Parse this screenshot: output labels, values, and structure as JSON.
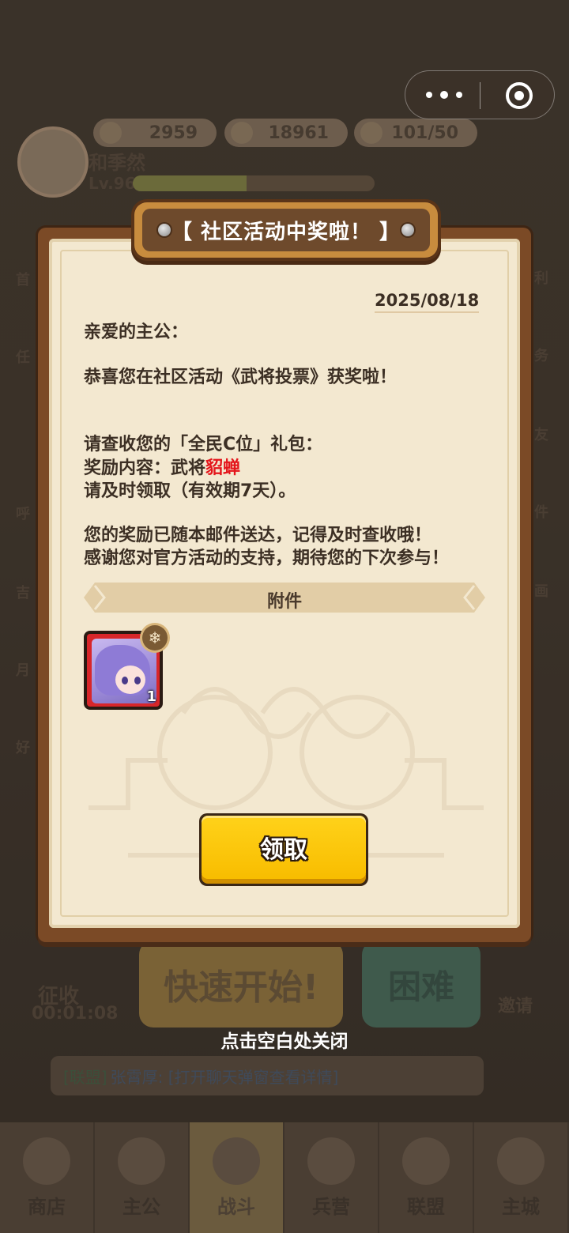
{
  "resources": [
    {
      "icon": "gold-ingot-icon",
      "value": "2959"
    },
    {
      "icon": "coin-icon",
      "value": "18961"
    },
    {
      "icon": "food-icon",
      "value": "101/50"
    }
  ],
  "player": {
    "name": "和季然",
    "level": "Lv.96",
    "xp_progress": 0.47
  },
  "side_left": [
    "首",
    "任",
    "呼",
    "吉",
    "月",
    "好"
  ],
  "side_right": [
    "利",
    "务",
    "友",
    "件",
    "画"
  ],
  "main_buttons": {
    "quick_start": "快速开始!",
    "hard": "困难",
    "collect": "征收",
    "collect_timer": "00:01:08",
    "invite": "邀请"
  },
  "chat": {
    "tag": "[联盟]",
    "text": "张霄厚: [打开聊天弹窗查看详情]"
  },
  "bottom_nav": [
    {
      "label": "商店",
      "icon": "shop-icon"
    },
    {
      "label": "主公",
      "icon": "lord-icon"
    },
    {
      "label": "战斗",
      "icon": "battle-icon",
      "active": true
    },
    {
      "label": "兵营",
      "icon": "barracks-icon"
    },
    {
      "label": "联盟",
      "icon": "alliance-icon"
    },
    {
      "label": "主城",
      "icon": "city-icon"
    }
  ],
  "dialog": {
    "title": "【 社区活动中奖啦！ 】",
    "date": "2025/08/18",
    "greeting": "亲爱的主公：",
    "congrats": "恭喜您在社区活动《武将投票》获奖啦！",
    "check_pack": "请查收您的「全民C位」礼包：",
    "reward_prefix": "奖励内容：武将",
    "reward_hero": "貂蝉",
    "claim_in_time": "请及时领取（有效期7天）。",
    "sent_note": "您的奖励已随本邮件送达，记得及时查收哦！",
    "thanks": "感谢您对官方活动的支持，期待您的下次参与！",
    "attachment_label": "附件",
    "attachment_item": {
      "name": "貂蝉",
      "quantity": "1"
    },
    "claim_button": "领取"
  },
  "close_hint": "点击空白处关闭",
  "colors": {
    "accent": "#f8bd00",
    "hero_name": "#e4151b",
    "paper": "#f3e8d0",
    "frame": "#7b4a26"
  }
}
